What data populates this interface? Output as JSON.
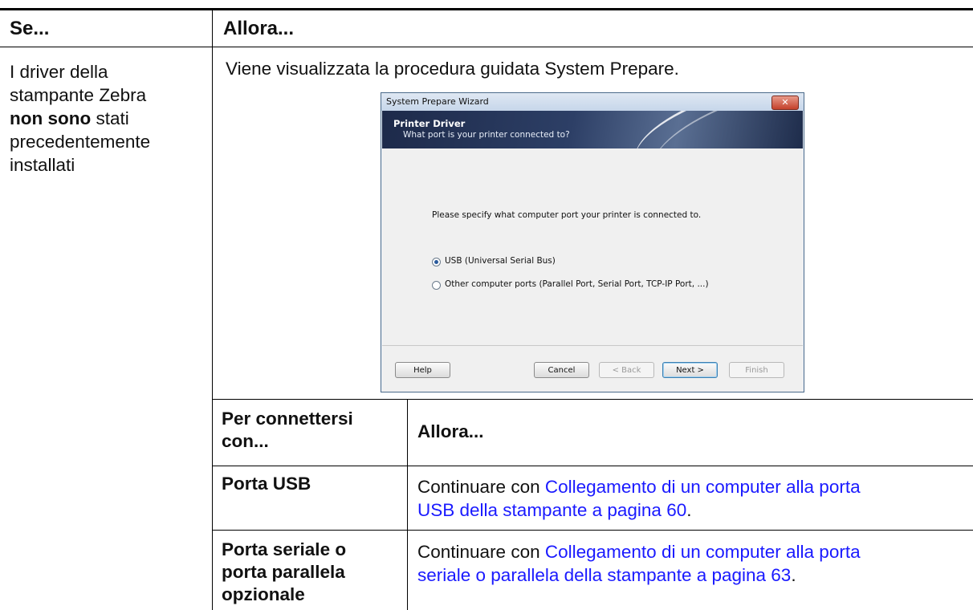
{
  "table": {
    "header_left": "Se...",
    "header_right": "Allora...",
    "condition": {
      "line1": "I driver della",
      "line2": "stampante Zebra",
      "bold": "non sono",
      "line3_rest": " stati",
      "line4": "precedentemente",
      "line5": "installati"
    },
    "intro_text": "Viene visualizzata la procedura guidata System Prepare."
  },
  "dialog": {
    "title": "System Prepare Wizard",
    "close_label": "✕",
    "banner_title": "Printer Driver",
    "banner_subtitle": "What port is your printer connected to?",
    "prompt": "Please specify what computer port your printer is connected to.",
    "options": [
      {
        "label": "USB (Universal Serial Bus)",
        "selected": true
      },
      {
        "label": "Other computer ports (Parallel Port, Serial Port, TCP-IP Port, ...)",
        "selected": false
      }
    ],
    "buttons": {
      "help": "Help",
      "cancel": "Cancel",
      "back": "< Back",
      "next": "Next >",
      "finish": "Finish"
    }
  },
  "inner_table": {
    "header_left_1": "Per connettersi",
    "header_left_2": "con...",
    "header_right": "Allora...",
    "rows": [
      {
        "left_1": "Porta USB",
        "right_prefix": "Continuare con ",
        "right_link_1": "Collegamento di un computer alla porta",
        "right_link_2": "USB della stampante a pagina 60",
        "right_suffix": "."
      },
      {
        "left_1": "Porta seriale o",
        "left_2": "porta parallela",
        "left_3": "opzionale",
        "right_prefix": "Continuare con ",
        "right_link_1": "Collegamento di un computer alla porta",
        "right_link_2": "seriale o parallela della stampante a pagina 63",
        "right_suffix": "."
      }
    ]
  }
}
